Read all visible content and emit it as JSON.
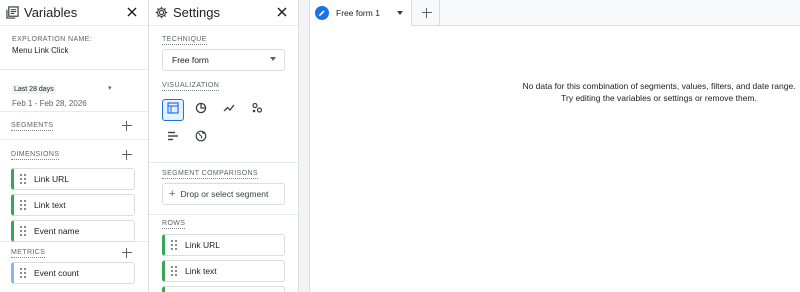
{
  "variables": {
    "title": "Variables",
    "exploration_label": "EXPLORATION NAME:",
    "exploration_name": "Menu Link Click",
    "date_preset": "Last 28 days",
    "date_range": "Feb 1 - Feb 28, 2026",
    "segments_label": "SEGMENTS",
    "dimensions_label": "DIMENSIONS",
    "dimensions": [
      "Link URL",
      "Link text",
      "Event name"
    ],
    "metrics_label": "METRICS",
    "metrics": [
      "Event count"
    ]
  },
  "settings": {
    "title": "Settings",
    "technique_label": "TECHNIQUE",
    "technique_value": "Free form",
    "visualization_label": "VISUALIZATION",
    "segment_comparisons_label": "SEGMENT COMPARISONS",
    "segment_placeholder": "Drop or select segment",
    "rows_label": "ROWS",
    "rows": [
      "Link URL",
      "Link text"
    ]
  },
  "tabs": [
    {
      "label": "Free form 1"
    }
  ],
  "main": {
    "message_line1": "No data for this combination of segments, values, filters, and date range.",
    "message_line2": "Try editing the variables or settings or remove them."
  },
  "colors": {
    "accent": "#1a73e8",
    "dimension_chip": "#34a853",
    "metric_chip": "#8ab4f8"
  }
}
